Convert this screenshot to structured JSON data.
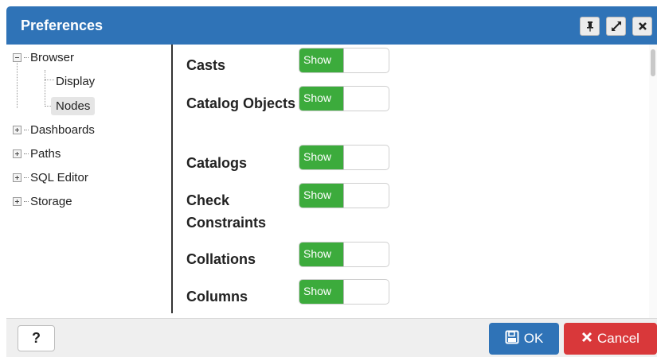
{
  "dialog": {
    "title": "Preferences",
    "window_buttons": [
      {
        "name": "pin-icon"
      },
      {
        "name": "maximize-icon"
      },
      {
        "name": "close-icon"
      }
    ]
  },
  "tree": {
    "items": [
      {
        "label": "Browser",
        "expanded": true
      },
      {
        "label": "Display"
      },
      {
        "label": "Nodes",
        "selected": true
      },
      {
        "label": "Dashboards",
        "expanded": false
      },
      {
        "label": "Paths",
        "expanded": false
      },
      {
        "label": "SQL Editor",
        "expanded": false
      },
      {
        "label": "Storage",
        "expanded": false
      }
    ]
  },
  "settings": [
    {
      "label": "Casts",
      "value": "Show"
    },
    {
      "label": "Catalog Objects",
      "value": "Show"
    },
    {
      "label": "Catalogs",
      "value": "Show"
    },
    {
      "label": "Check Constraints",
      "value": "Show"
    },
    {
      "label": "Collations",
      "value": "Show"
    },
    {
      "label": "Columns",
      "value": "Show"
    }
  ],
  "footer": {
    "help_label": "?",
    "ok_label": "OK",
    "cancel_label": "Cancel"
  },
  "colors": {
    "header": "#2f73b7",
    "toggle_on": "#3cab3c",
    "ok": "#2f73b7",
    "cancel": "#d9383a"
  }
}
